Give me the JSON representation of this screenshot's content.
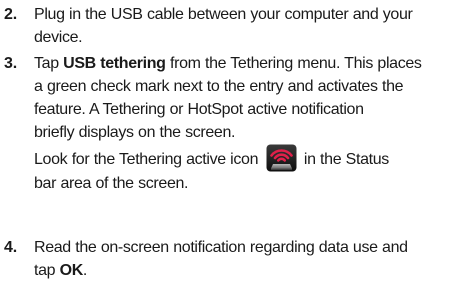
{
  "steps": [
    {
      "number": "2.",
      "lines": [
        "Plug in the USB cable between your computer and your",
        "device."
      ]
    },
    {
      "number": "3.",
      "lines": [
        {
          "pre": "Tap ",
          "bold": "USB tethering",
          "post": " from the Tethering menu. This places"
        },
        "a green check mark next to the entry and activates the",
        "feature. A Tethering or HotSpot active notification",
        "briefly displays on the screen.",
        {
          "pre": "Look for the Tethering active icon ",
          "icon": "tethering-active-icon",
          "post": " in the Status"
        },
        "bar area of the screen."
      ]
    },
    {
      "number": "4.",
      "lines": [
        "Read the on-screen notification regarding data use and",
        {
          "pre": "tap ",
          "bold": "OK",
          "post": "."
        }
      ]
    }
  ],
  "icons": {
    "tethering_active": {
      "name": "tethering-active-icon",
      "colors": {
        "tile_top": "#3a3a3a",
        "tile_bottom": "#0e0e0e",
        "waves": "#e0204a"
      }
    }
  }
}
